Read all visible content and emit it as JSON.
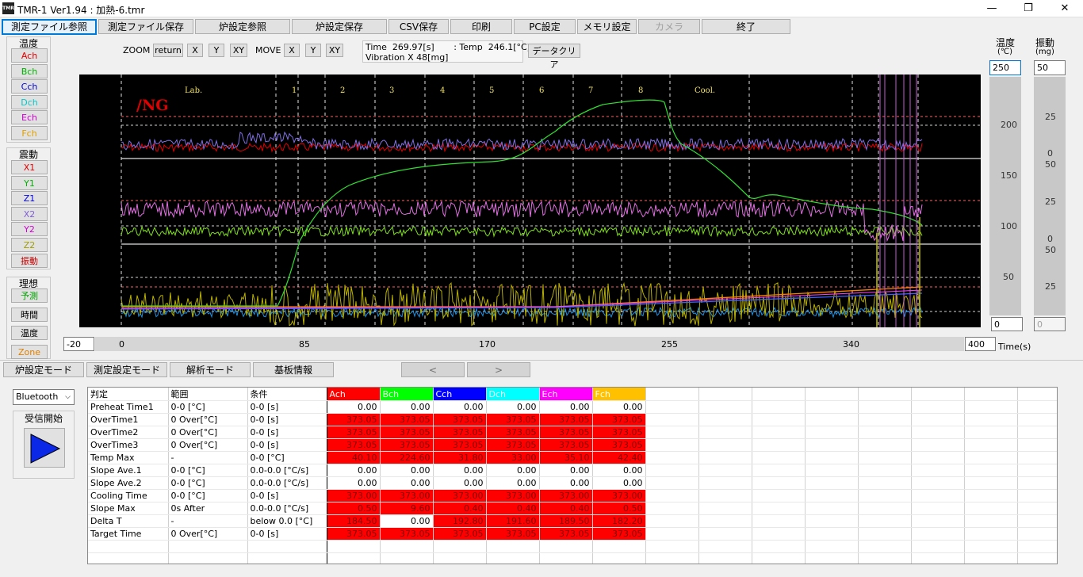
{
  "window": {
    "title": "TMR-1 Ver1.94 : 加熱-6.tmr",
    "icon_label": "TMR",
    "minimize": "—",
    "maximize": "❐",
    "close": "✕"
  },
  "toolbar": {
    "items": [
      "測定ファイル参照",
      "測定ファイル保存",
      "炉設定参照",
      "炉設定保存",
      "CSV保存",
      "印刷",
      "PC設定",
      "メモリ設定",
      "カメラ",
      "終了"
    ]
  },
  "zoom": {
    "label": "ZOOM",
    "buttons": [
      "return",
      "X",
      "Y",
      "XY"
    ]
  },
  "move": {
    "label": "MOVE",
    "buttons": [
      "X",
      "Y",
      "XY"
    ]
  },
  "readout": {
    "line1": "Time  269.97[s]       : Temp  246.1[°C]",
    "line2": "Vibration X 48[mg]"
  },
  "clear_button": "データクリア",
  "left_panel": {
    "temp_header": "温度",
    "temp_channels": [
      {
        "label": "Ach",
        "color": "#e00000"
      },
      {
        "label": "Bch",
        "color": "#00b000"
      },
      {
        "label": "Cch",
        "color": "#0000e0"
      },
      {
        "label": "Dch",
        "color": "#00c8c8"
      },
      {
        "label": "Ech",
        "color": "#d000d0"
      },
      {
        "label": "Fch",
        "color": "#e0a000"
      }
    ],
    "vib_header": "震動",
    "vib_channels": [
      {
        "label": "X1",
        "color": "#e00000"
      },
      {
        "label": "Y1",
        "color": "#00b000"
      },
      {
        "label": "Z1",
        "color": "#0000e0"
      },
      {
        "label": "X2",
        "color": "#8060d0"
      },
      {
        "label": "Y2",
        "color": "#d000d0"
      },
      {
        "label": "Z2",
        "color": "#a0a000"
      },
      {
        "label": "振動",
        "color": "#c00000"
      }
    ],
    "ideal_header": "理想",
    "ideal_items": [
      {
        "label": "予測",
        "color": "#00a000"
      },
      {
        "label": "時間",
        "color": "#000000"
      },
      {
        "label": "温度",
        "color": "#000000"
      },
      {
        "label": "Zone",
        "color": "#e08000"
      }
    ]
  },
  "plot": {
    "ng_text": "/NG",
    "zones": [
      "Lab.",
      "1",
      "2",
      "3",
      "4",
      "5",
      "6",
      "7",
      "8",
      "Cool."
    ]
  },
  "temp_scale": {
    "header": "温度",
    "unit": "(℃)",
    "max_value": "250",
    "min_value": "0",
    "ticks": [
      "200",
      "150",
      "100",
      "50"
    ]
  },
  "vib_scale": {
    "header": "振動",
    "unit": "(mg)",
    "max_value": "50",
    "min_value": "0",
    "ticks": [
      "25",
      "0",
      "50",
      "25",
      "0",
      "50",
      "25"
    ]
  },
  "x_axis": {
    "min_value": "-20",
    "max_value": "400",
    "ticks": [
      "0",
      "85",
      "170",
      "255",
      "340"
    ],
    "unit": "Time(s)"
  },
  "mode_tabs": [
    "炉設定モード",
    "測定設定モード",
    "解析モード",
    "基板情報"
  ],
  "nav": {
    "prev": "<",
    "next": ">"
  },
  "bluetooth": {
    "selected": "Bluetooth",
    "receive_label": "受信開始"
  },
  "table": {
    "headers": [
      "判定",
      "範囲",
      "条件",
      "Ach",
      "Bch",
      "Cch",
      "Dch",
      "Ech",
      "Fch"
    ],
    "header_colors": [
      "#ff0000",
      "#00ff00",
      "#0000ff",
      "#00ffff",
      "#ff00ff",
      "#ffc000"
    ],
    "rows": [
      {
        "name": "Preheat Time1",
        "range": "0-0 [°C]",
        "cond": "0-0 [s]",
        "vals": [
          "0.00",
          "0.00",
          "0.00",
          "0.00",
          "0.00",
          "0.00"
        ],
        "red": [
          0,
          0,
          0,
          0,
          0,
          0
        ]
      },
      {
        "name": "OverTime1",
        "range": "0 Over[°C]",
        "cond": "0-0 [s]",
        "vals": [
          "373.05",
          "373.05",
          "373.05",
          "373.05",
          "373.05",
          "373.05"
        ],
        "red": [
          1,
          1,
          1,
          1,
          1,
          1
        ]
      },
      {
        "name": "OverTime2",
        "range": "0 Over[°C]",
        "cond": "0-0 [s]",
        "vals": [
          "373.05",
          "373.05",
          "373.05",
          "373.05",
          "373.05",
          "373.05"
        ],
        "red": [
          1,
          1,
          1,
          1,
          1,
          1
        ]
      },
      {
        "name": "OverTime3",
        "range": "0 Over[°C]",
        "cond": "0-0 [s]",
        "vals": [
          "373.05",
          "373.05",
          "373.05",
          "373.05",
          "373.05",
          "373.05"
        ],
        "red": [
          1,
          1,
          1,
          1,
          1,
          1
        ]
      },
      {
        "name": "Temp Max",
        "range": "-",
        "cond": "0-0 [°C]",
        "vals": [
          "40.10",
          "224.60",
          "31.80",
          "33.00",
          "35.10",
          "42.40"
        ],
        "red": [
          1,
          1,
          1,
          1,
          1,
          1
        ]
      },
      {
        "name": "Slope Ave.1",
        "range": "0-0 [°C]",
        "cond": "0.0-0.0 [°C/s]",
        "vals": [
          "0.00",
          "0.00",
          "0.00",
          "0.00",
          "0.00",
          "0.00"
        ],
        "red": [
          0,
          0,
          0,
          0,
          0,
          0
        ]
      },
      {
        "name": "Slope Ave.2",
        "range": "0-0 [°C]",
        "cond": "0.0-0.0 [°C/s]",
        "vals": [
          "0.00",
          "0.00",
          "0.00",
          "0.00",
          "0.00",
          "0.00"
        ],
        "red": [
          0,
          0,
          0,
          0,
          0,
          0
        ]
      },
      {
        "name": "Cooling Time",
        "range": "0-0 [°C]",
        "cond": "0-0 [s]",
        "vals": [
          "373.00",
          "373.00",
          "373.00",
          "373.00",
          "373.00",
          "373.00"
        ],
        "red": [
          1,
          1,
          1,
          1,
          1,
          1
        ]
      },
      {
        "name": "Slope Max",
        "range": "0s After",
        "cond": "0.0-0.0 [°C/s]",
        "vals": [
          "0.50",
          "9.60",
          "0.40",
          "0.40",
          "0.40",
          "0.50"
        ],
        "red": [
          1,
          1,
          1,
          1,
          1,
          1
        ]
      },
      {
        "name": "Delta T",
        "range": "-",
        "cond": "below 0.0 [°C]",
        "vals": [
          "184.50",
          "0.00",
          "192.80",
          "191.60",
          "189.50",
          "182.20"
        ],
        "red": [
          1,
          0,
          1,
          1,
          1,
          1
        ]
      },
      {
        "name": "Target Time",
        "range": "0 Over[°C]",
        "cond": "0-0 [s]",
        "vals": [
          "373.05",
          "373.05",
          "373.05",
          "373.05",
          "373.05",
          "373.05"
        ],
        "red": [
          1,
          1,
          1,
          1,
          1,
          1
        ]
      }
    ]
  }
}
